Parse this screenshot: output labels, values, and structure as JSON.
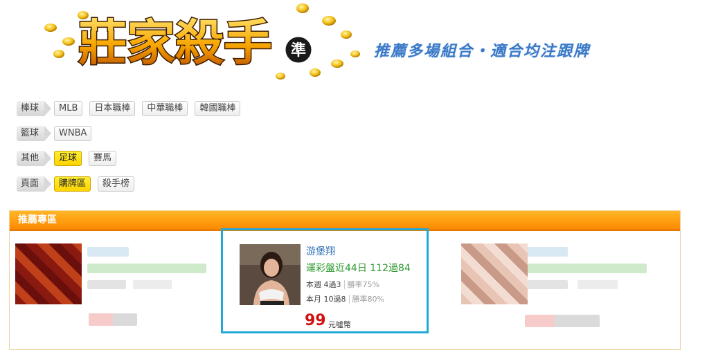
{
  "banner": {
    "title": "莊家殺手",
    "badge": "準"
  },
  "tagline": "推薦多場組合・適合均注跟牌",
  "rows": [
    {
      "category": "棒球",
      "tags": [
        "MLB",
        "日本職棒",
        "中華職棒",
        "韓國職棒"
      ]
    },
    {
      "category": "籃球",
      "tags": [
        "WNBA"
      ]
    },
    {
      "category": "其他",
      "tags": [
        "足球",
        "賽馬"
      ]
    },
    {
      "category": "頁面",
      "tags": [
        "購牌區",
        "殺手榜"
      ]
    }
  ],
  "panel": {
    "title": "推薦專區"
  },
  "featured": {
    "name": "游堡翔",
    "record": "運彩盤近44日 112過84",
    "week": "本週 4過3",
    "week_rate": "勝率75%",
    "month": "本月 10過8",
    "month_rate": "勝率80%",
    "price": "99",
    "unit": "元噓幣"
  },
  "colors": {
    "accent_blue": "#22a8d6",
    "price_red": "#d01010",
    "win_green": "#2c9a2c",
    "active_tag": "#ffd400"
  }
}
